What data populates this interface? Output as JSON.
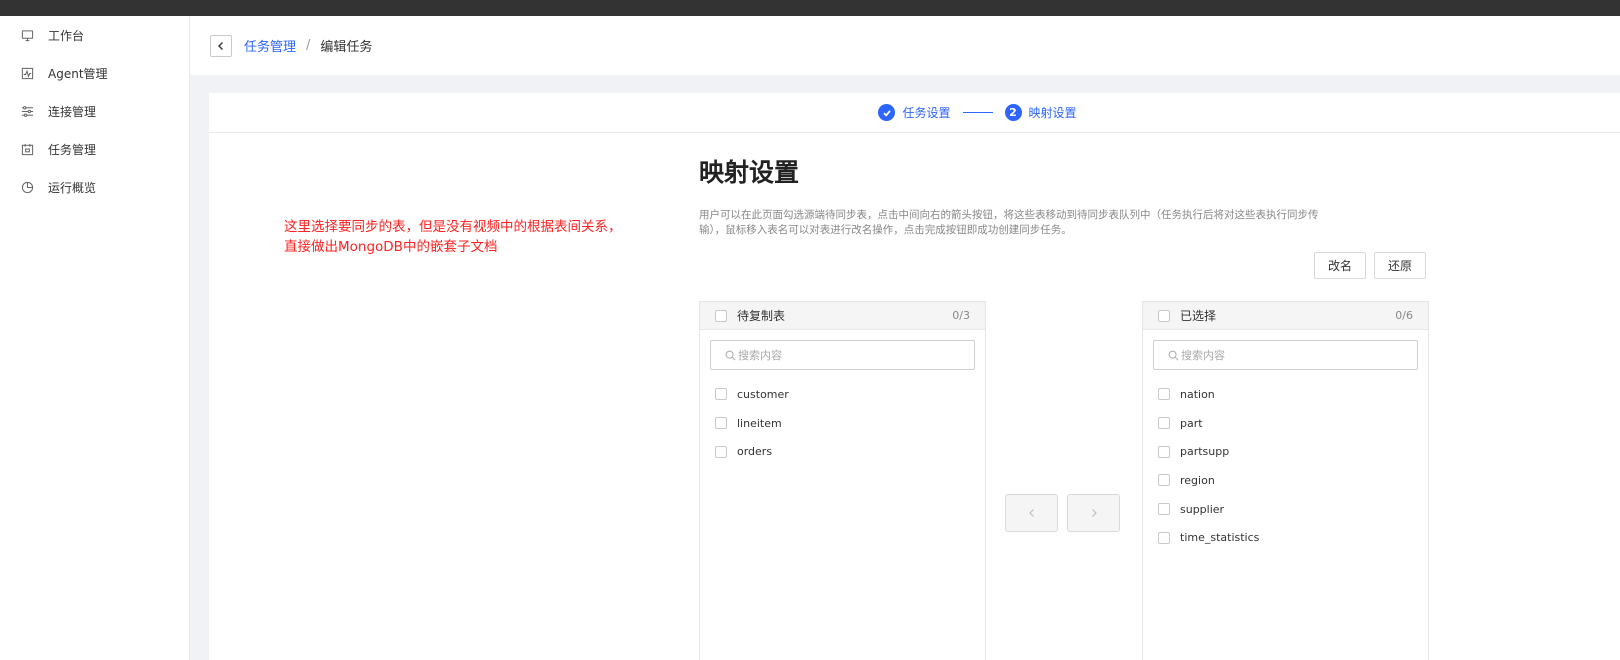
{
  "sidebar": {
    "items": [
      {
        "label": "工作台",
        "icon": "monitor-icon"
      },
      {
        "label": "Agent管理",
        "icon": "activity-icon"
      },
      {
        "label": "连接管理",
        "icon": "sliders-icon"
      },
      {
        "label": "任务管理",
        "icon": "calendar-icon"
      },
      {
        "label": "运行概览",
        "icon": "pie-chart-icon"
      }
    ]
  },
  "header": {
    "breadcrumb_parent": "任务管理",
    "breadcrumb_sep": "/",
    "breadcrumb_current": "编辑任务"
  },
  "steps": [
    {
      "label": "任务设置",
      "status": "done"
    },
    {
      "label": "映射设置",
      "number": "2",
      "status": "active"
    }
  ],
  "annotation": {
    "line1": "这里选择要同步的表，但是没有视频中的根据表间关系，",
    "line2": "直接做出MongoDB中的嵌套子文档"
  },
  "main": {
    "title": "映射设置",
    "description": "用户可以在此页面勾选源端待同步表，点击中间向右的箭头按钮，将这些表移动到待同步表队列中（任务执行后将对这些表执行同步传输），鼠标移入表名可以对表进行改名操作，点击完成按钮即成功创建同步任务。",
    "rename_button": "改名",
    "restore_button": "还原"
  },
  "left_panel": {
    "title": "待复制表",
    "count": "0/3",
    "search_placeholder": "搜索内容",
    "items": [
      "customer",
      "lineitem",
      "orders"
    ]
  },
  "right_panel": {
    "title": "已选择",
    "count": "0/6",
    "search_placeholder": "搜索内容",
    "items": [
      "nation",
      "part",
      "partsupp",
      "region",
      "supplier",
      "time_statistics"
    ]
  },
  "colors": {
    "accent": "#2c65ff",
    "annotation": "#ff2222",
    "topbar": "#333333"
  }
}
